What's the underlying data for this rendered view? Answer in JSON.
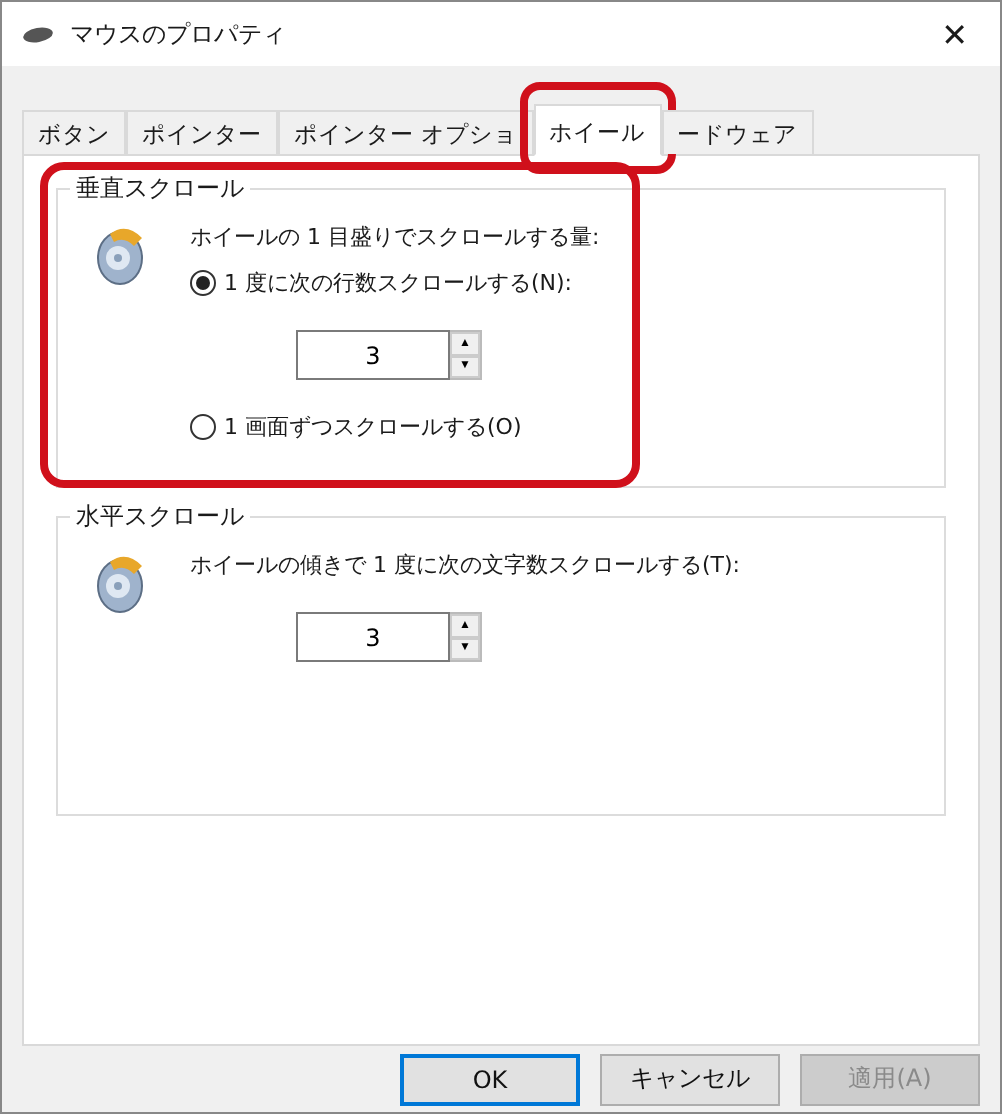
{
  "window": {
    "title": "マウスのプロパティ",
    "close": "✕"
  },
  "tabs": [
    {
      "label": "ボタン",
      "selected": false,
      "highlighted": false
    },
    {
      "label": "ポインター",
      "selected": false,
      "highlighted": false
    },
    {
      "label": "ポインター オプショ",
      "selected": false,
      "highlighted": false
    },
    {
      "label": "ホイール",
      "selected": true,
      "highlighted": true
    },
    {
      "label": "ードウェア",
      "selected": false,
      "highlighted": false
    }
  ],
  "groups": [
    {
      "title": "垂直スクロール",
      "highlighted": true,
      "prompt": "ホイールの 1 目盛りでスクロールする量:",
      "options": [
        {
          "kind": "radio",
          "label": "1 度に次の行数スクロールする(N):",
          "selected": true
        },
        {
          "kind": "spinner",
          "value": "3",
          "up": "▲",
          "down": "▼"
        },
        {
          "kind": "radio",
          "label": "1 画面ずつスクロールする(O)",
          "selected": false
        }
      ]
    },
    {
      "title": "水平スクロール",
      "highlighted": false,
      "prompt": "ホイールの傾きで 1 度に次の文字数スクロールする(T):",
      "options": [
        {
          "kind": "spinner",
          "value": "3",
          "up": "▲",
          "down": "▼"
        }
      ]
    }
  ],
  "buttons": [
    {
      "label": "OK",
      "default": true,
      "disabled": false
    },
    {
      "label": "キャンセル",
      "default": false,
      "disabled": false
    },
    {
      "label": "適用(A)",
      "default": false,
      "disabled": true
    }
  ]
}
